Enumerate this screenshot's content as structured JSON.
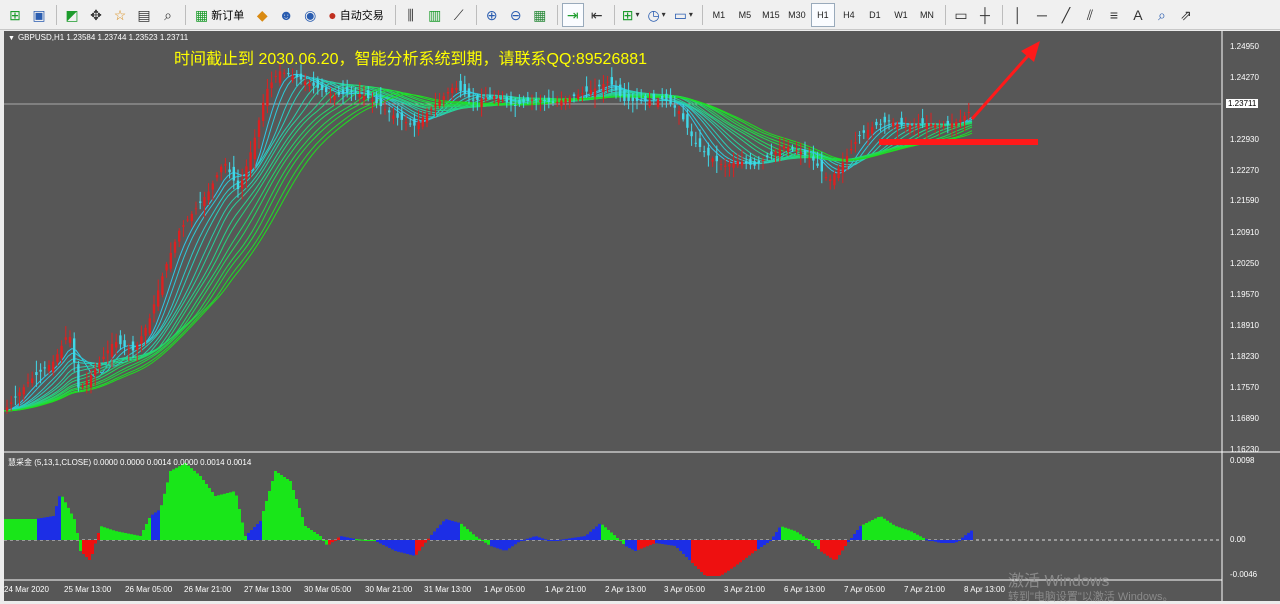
{
  "toolbar": {
    "new_order_label": "新订单",
    "auto_trading_label": "自动交易",
    "timeframes": [
      "M1",
      "M5",
      "M15",
      "M30",
      "H1",
      "H4",
      "D1",
      "W1",
      "MN"
    ],
    "active_timeframe": "H1"
  },
  "chart": {
    "symbol_info": "GBPUSD,H1  1.23584 1.23744 1.23523 1.23711",
    "notice": "时间截止到 2030.06.20，智能分析系统到期，请联系QQ:89526881",
    "current_price": "1.23711",
    "price_ticks": [
      "1.24950",
      "1.24270",
      "1.23711",
      "1.22930",
      "1.22270",
      "1.21590",
      "1.20910",
      "1.20250",
      "1.19570",
      "1.18910",
      "1.18230",
      "1.17570",
      "1.16890",
      "1.16230"
    ],
    "indicator_label": "慧采金 (5,13,1,CLOSE) 0.0000 0.0000 0.0014 0.0000 0.0014 0.0014",
    "indicator_ticks": [
      "0.0098",
      "0.00",
      "-0.0046"
    ],
    "time_ticks": [
      "24 Mar 2020",
      "25 Mar 13:00",
      "26 Mar 05:00",
      "26 Mar 21:00",
      "27 Mar 13:00",
      "30 Mar 05:00",
      "30 Mar 21:00",
      "31 Mar 13:00",
      "1 Apr 05:00",
      "1 Apr 21:00",
      "2 Apr 13:00",
      "3 Apr 05:00",
      "3 Apr 21:00",
      "6 Apr 13:00",
      "7 Apr 05:00",
      "7 Apr 21:00",
      "8 Apr 13:00"
    ]
  },
  "watermark": {
    "line1": "激活 Windows",
    "line2": "转到\"电脑设置\"以激活 Windows。"
  },
  "colors": {
    "chart_bg": "#575757",
    "bull": "#dd2020",
    "bear": "#3fd8e8",
    "ribbon_fast": "#2ec8e8",
    "ribbon_slow": "#1ee01e",
    "hist_pos": "#19e619",
    "hist_blue": "#1c2ee6",
    "hist_red": "#ee1010",
    "notice": "#ffff00"
  }
}
